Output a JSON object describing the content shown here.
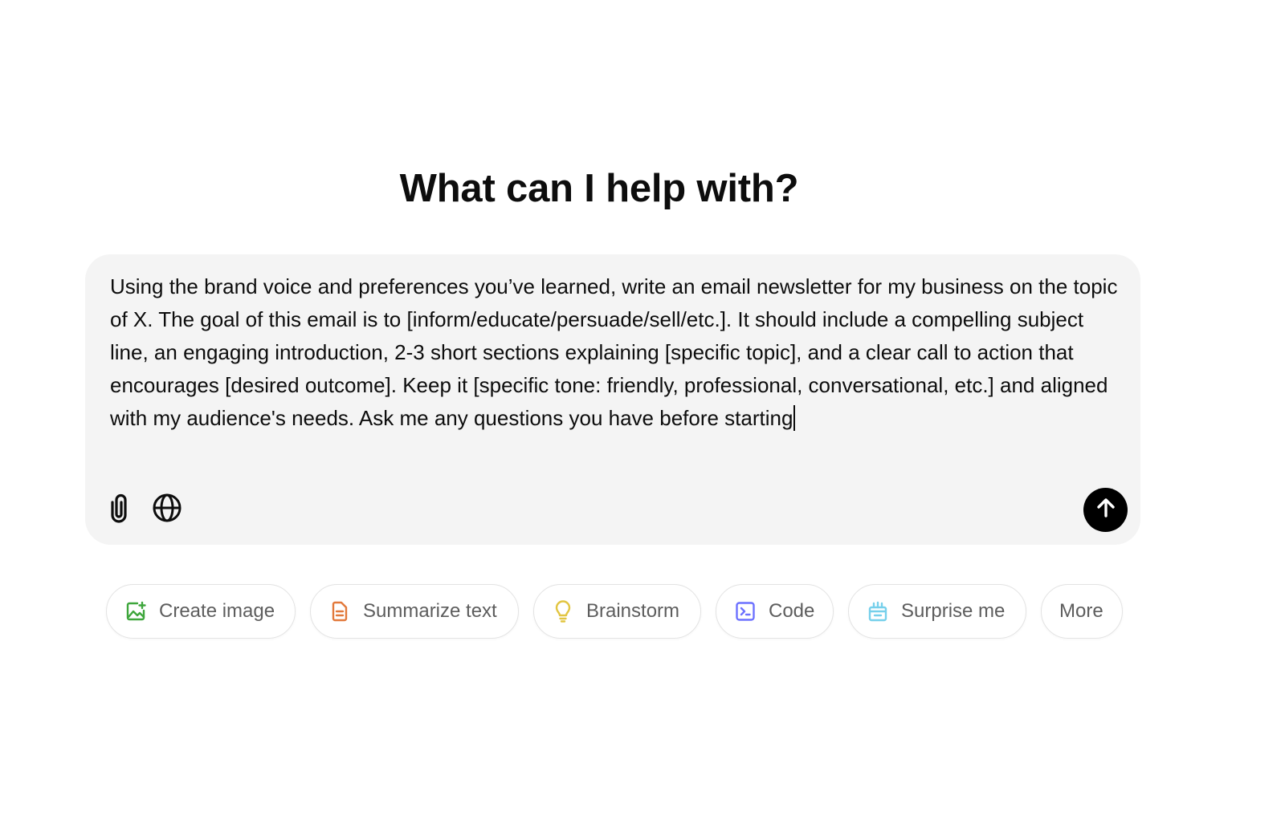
{
  "main": {
    "headline": "What can I help with?"
  },
  "composer": {
    "value": "Using the brand voice and preferences you’ve learned, write an email newsletter for my business on the topic of X. The goal of this email is to [inform/educate/persuade/sell/etc.]. It should include a compelling subject line, an engaging introduction, 2-3 short sections explaining [specific topic], and a clear call to action that encourages [desired outcome]. Keep it [specific tone: friendly, professional, conversational, etc.] and aligned with my audience's needs. Ask me any questions you have before starting",
    "tools": [
      {
        "icon": "paperclip-icon"
      },
      {
        "icon": "globe-icon"
      }
    ],
    "send_icon": "arrow-up-icon"
  },
  "suggestions": [
    {
      "label": "Create image",
      "icon": "image-icon",
      "color": "#3ea63c"
    },
    {
      "label": "Summarize text",
      "icon": "document-icon",
      "color": "#e2793b"
    },
    {
      "label": "Brainstorm",
      "icon": "lightbulb-icon",
      "color": "#e2c541"
    },
    {
      "label": "Code",
      "icon": "terminal-icon",
      "color": "#6c71ff"
    },
    {
      "label": "Surprise me",
      "icon": "gift-icon",
      "color": "#76d0eb"
    },
    {
      "label": "More",
      "icon": "",
      "color": "#5d5d5d"
    }
  ]
}
